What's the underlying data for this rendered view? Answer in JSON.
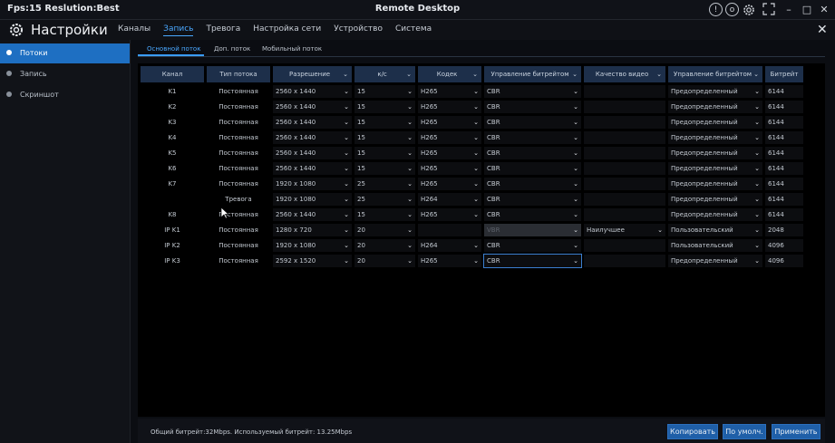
{
  "titlebar": {
    "fps": "Fps:15 Reslution:Best",
    "title": "Remote Desktop"
  },
  "header": {
    "title": "Настройки",
    "nav": [
      {
        "label": "Каналы",
        "active": false
      },
      {
        "label": "Запись",
        "active": true
      },
      {
        "label": "Тревога",
        "active": false
      },
      {
        "label": "Настройка сети",
        "active": false
      },
      {
        "label": "Устройство",
        "active": false
      },
      {
        "label": "Система",
        "active": false
      }
    ]
  },
  "sidebar": {
    "items": [
      {
        "label": "Потоки",
        "active": true
      },
      {
        "label": "Запись",
        "active": false
      },
      {
        "label": "Скриншот",
        "active": false
      }
    ]
  },
  "subtabs": [
    {
      "label": "Основной поток",
      "active": true
    },
    {
      "label": "Доп. поток",
      "active": false
    },
    {
      "label": "Мобильный поток",
      "active": false
    }
  ],
  "table": {
    "columns": [
      "Канал",
      "Тип потока",
      "Разрешение",
      "к/с",
      "Кодек",
      "Управление битрейтом",
      "Качество видео",
      "Управление битрейтом",
      "Битрейт"
    ],
    "rows": [
      {
        "channel": "K1",
        "type": "Постоянная",
        "resolution": "2560 x 1440",
        "fps": "15",
        "codec": "H265",
        "bitrate_ctrl": "CBR",
        "quality": "",
        "bitrate_mode": "Предопределенный",
        "bitrate": "6144"
      },
      {
        "channel": "K2",
        "type": "Постоянная",
        "resolution": "2560 x 1440",
        "fps": "15",
        "codec": "H265",
        "bitrate_ctrl": "CBR",
        "quality": "",
        "bitrate_mode": "Предопределенный",
        "bitrate": "6144"
      },
      {
        "channel": "K3",
        "type": "Постоянная",
        "resolution": "2560 x 1440",
        "fps": "15",
        "codec": "H265",
        "bitrate_ctrl": "CBR",
        "quality": "",
        "bitrate_mode": "Предопределенный",
        "bitrate": "6144"
      },
      {
        "channel": "K4",
        "type": "Постоянная",
        "resolution": "2560 x 1440",
        "fps": "15",
        "codec": "H265",
        "bitrate_ctrl": "CBR",
        "quality": "",
        "bitrate_mode": "Предопределенный",
        "bitrate": "6144"
      },
      {
        "channel": "K5",
        "type": "Постоянная",
        "resolution": "2560 x 1440",
        "fps": "15",
        "codec": "H265",
        "bitrate_ctrl": "CBR",
        "quality": "",
        "bitrate_mode": "Предопределенный",
        "bitrate": "6144"
      },
      {
        "channel": "K6",
        "type": "Постоянная",
        "resolution": "2560 x 1440",
        "fps": "15",
        "codec": "H265",
        "bitrate_ctrl": "CBR",
        "quality": "",
        "bitrate_mode": "Предопределенный",
        "bitrate": "6144"
      },
      {
        "channel": "K7",
        "type": "Постоянная",
        "resolution": "1920 x 1080",
        "fps": "25",
        "codec": "H265",
        "bitrate_ctrl": "CBR",
        "quality": "",
        "bitrate_mode": "Предопределенный",
        "bitrate": "6144"
      },
      {
        "channel": "",
        "type": "Тревога",
        "resolution": "1920 x 1080",
        "fps": "25",
        "codec": "H264",
        "bitrate_ctrl": "CBR",
        "quality": "",
        "bitrate_mode": "Предопределенный",
        "bitrate": "6144"
      },
      {
        "channel": "K8",
        "type": "Постоянная",
        "resolution": "2560 x 1440",
        "fps": "15",
        "codec": "H265",
        "bitrate_ctrl": "CBR",
        "quality": "",
        "bitrate_mode": "Предопределенный",
        "bitrate": "6144"
      },
      {
        "channel": "IP K1",
        "type": "Постоянная",
        "resolution": "1280 x 720",
        "fps": "20",
        "codec": "",
        "bitrate_ctrl": "VBR",
        "quality": "Наилучшее",
        "bitrate_mode": "Пользовательский",
        "bitrate": "2048"
      },
      {
        "channel": "IP K2",
        "type": "Постоянная",
        "resolution": "1920 x 1080",
        "fps": "20",
        "codec": "H264",
        "bitrate_ctrl": "CBR",
        "quality": "",
        "bitrate_mode": "Пользовательский",
        "bitrate": "4096"
      },
      {
        "channel": "IP K3",
        "type": "Постоянная",
        "resolution": "2592 x 1520",
        "fps": "20",
        "codec": "H265",
        "bitrate_ctrl": "CBR",
        "quality": "",
        "bitrate_mode": "Предопределенный",
        "bitrate": "4096"
      }
    ]
  },
  "footer": {
    "info": "Общий битрейт:32Mbps. Используемый битрейт: 13.25Mbps",
    "buttons": [
      "Копировать",
      "По умолч.",
      "Применить"
    ]
  }
}
